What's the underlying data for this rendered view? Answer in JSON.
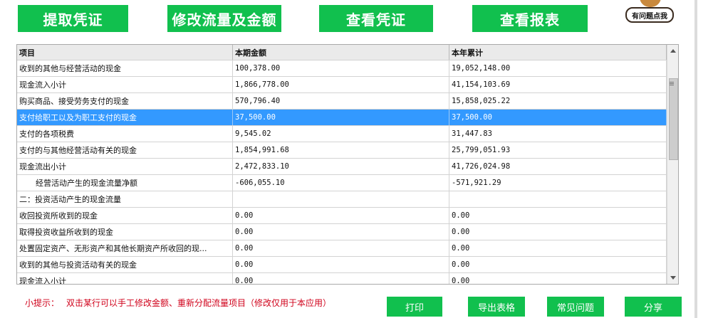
{
  "toolbar": {
    "extract": "提取凭证",
    "modify": "修改流量及金额",
    "view": "查看凭证",
    "report": "查看报表"
  },
  "help": {
    "label": "有问题点我"
  },
  "table": {
    "headers": [
      "项目",
      "本期金额",
      "本年累计"
    ],
    "rows": [
      [
        "收到的其他与经营活动的现金",
        "100,378.00",
        "19,052,148.00"
      ],
      [
        "现金流入小计",
        "1,866,778.00",
        "41,154,103.69"
      ],
      [
        "购买商品、接受劳务支付的现金",
        "570,796.40",
        "15,858,025.22"
      ],
      [
        "支付给职工以及为职工支付的现金",
        "37,500.00",
        "37,500.00"
      ],
      [
        "支付的各项税费",
        "9,545.02",
        "31,447.83"
      ],
      [
        "支付的与其他经营活动有关的现金",
        "1,854,991.68",
        "25,799,051.93"
      ],
      [
        "现金流出小计",
        "2,472,833.10",
        "41,726,024.98"
      ],
      [
        "经营活动产生的现金流量净额",
        "-606,055.10",
        "-571,921.29"
      ],
      [
        "二：投资活动产生的现金流量",
        "",
        ""
      ],
      [
        "收回投资所收到的现金",
        "0.00",
        "0.00"
      ],
      [
        "取得投资收益所收到的现金",
        "0.00",
        "0.00"
      ],
      [
        "处置固定资产、无形资产和其他长期资产所收回的现...",
        "0.00",
        "0.00"
      ],
      [
        "收到的其他与投资活动有关的现金",
        "0.00",
        "0.00"
      ],
      [
        "现金流入小计",
        "0.00",
        "0.00"
      ]
    ]
  },
  "tip": {
    "label": "小提示：",
    "text": "双击某行可以手工修改金额、重新分配流量项目（修改仅用于本应用）"
  },
  "footer": {
    "print": "打印",
    "export": "导出表格",
    "faq": "常见问题",
    "share": "分享"
  }
}
